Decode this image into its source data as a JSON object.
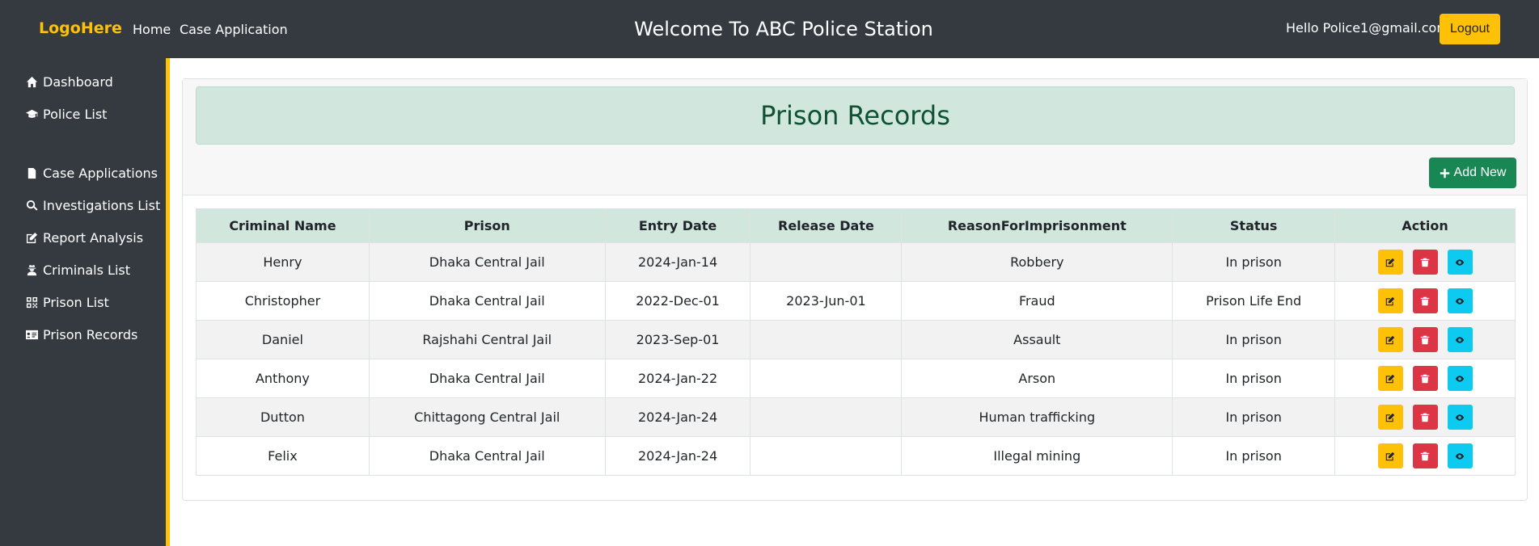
{
  "header": {
    "logo": "LogoHere",
    "nav": [
      "Home",
      "Case Application"
    ],
    "title": "Welcome To ABC Police Station",
    "greeting": "Hello Police1@gmail.com!",
    "logout": "Logout"
  },
  "sidebar": {
    "items": [
      {
        "label": "Dashboard",
        "icon": "home-icon"
      },
      {
        "label": "Police List",
        "icon": "graduation-cap-icon"
      },
      {
        "label": "Case Applications",
        "icon": "file-icon"
      },
      {
        "label": "Investigations List",
        "icon": "search-icon"
      },
      {
        "label": "Report Analysis",
        "icon": "edit-icon"
      },
      {
        "label": "Criminals List",
        "icon": "user-secret-icon"
      },
      {
        "label": "Prison List",
        "icon": "qrcode-icon"
      },
      {
        "label": "Prison Records",
        "icon": "id-card-icon"
      }
    ]
  },
  "main": {
    "banner": "Prison Records",
    "add_new": "Add New",
    "columns": [
      "Criminal Name",
      "Prison",
      "Entry Date",
      "Release Date",
      "ReasonForImprisonment",
      "Status",
      "Action"
    ],
    "rows": [
      {
        "name": "Henry",
        "prison": "Dhaka Central Jail",
        "entry": "2024-Jan-14",
        "release": "",
        "reason": "Robbery",
        "status": "In prison"
      },
      {
        "name": "Christopher",
        "prison": "Dhaka Central Jail",
        "entry": "2022-Dec-01",
        "release": "2023-Jun-01",
        "reason": "Fraud",
        "status": "Prison Life End"
      },
      {
        "name": "Daniel",
        "prison": "Rajshahi Central Jail",
        "entry": "2023-Sep-01",
        "release": "",
        "reason": "Assault",
        "status": "In prison"
      },
      {
        "name": "Anthony",
        "prison": "Dhaka Central Jail",
        "entry": "2024-Jan-22",
        "release": "",
        "reason": "Arson",
        "status": "In prison"
      },
      {
        "name": "Dutton",
        "prison": "Chittagong Central Jail",
        "entry": "2024-Jan-24",
        "release": "",
        "reason": "Human trafficking",
        "status": "In prison"
      },
      {
        "name": "Felix",
        "prison": "Dhaka Central Jail",
        "entry": "2024-Jan-24",
        "release": "",
        "reason": "Illegal mining",
        "status": "In prison"
      }
    ]
  },
  "colors": {
    "topbar": "#343a40",
    "accent": "#ffc107",
    "banner_bg": "#d1e7dd",
    "banner_text": "#0f5132",
    "add_button": "#198754",
    "delete_button": "#dc3545",
    "view_button": "#0dcaf0"
  }
}
